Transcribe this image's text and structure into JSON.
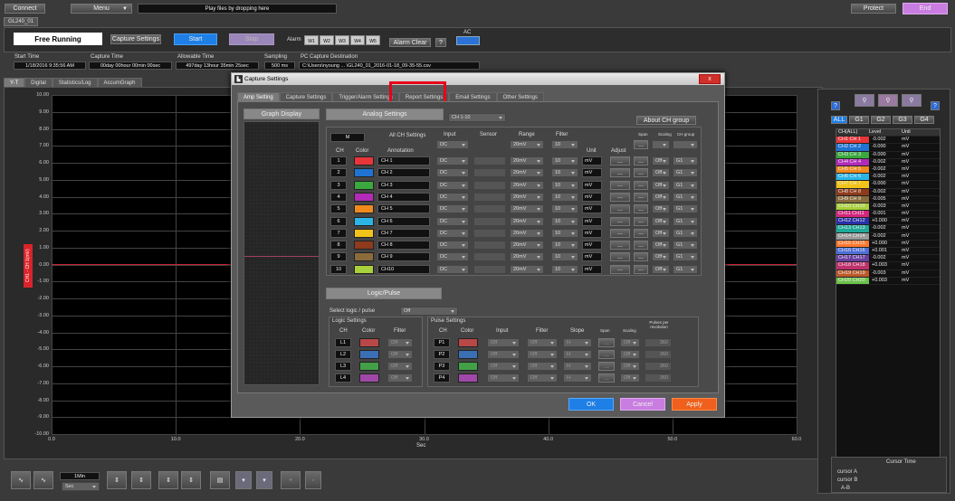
{
  "top": {
    "connect": "Connect",
    "menu": "Menu",
    "drop": "Play files by dropping here",
    "protect": "Protect",
    "end": "End"
  },
  "device_tab": "GL240_01",
  "status": {
    "mode": "Free Running",
    "capture_settings": "Capture Settings",
    "start": "Start",
    "stop": "Stop",
    "alarm_label": "Alarm",
    "alarms": [
      "W1",
      "W2",
      "W3",
      "W4",
      "W5"
    ],
    "alarm_clear": "Alarm Clear",
    "help": "?",
    "ac_label": "AC"
  },
  "info": {
    "start_time_label": "Start Time",
    "start_time": "1/18/2016 9:35:56 AM",
    "capture_time_label": "Capture Time",
    "capture_time": "00day 00hour 00min 00sec",
    "allowable_label": "Allowable Time",
    "allowable": "497day 13hour 35min 25sec",
    "sampling_label": "Sampling",
    "sampling": "500 ms",
    "dest_label": "PC Capture Destination",
    "dest": "C:\\Users\\nyoung ... \\GL240_01_2016-01-18_09-35-55.csv"
  },
  "view_tabs": [
    "Y-T",
    "Digital",
    "Statistics/Log",
    "AccumGraph"
  ],
  "graph": {
    "y_ticks": [
      "10.00",
      "9.00",
      "8.00",
      "7.00",
      "6.00",
      "5.00",
      "4.00",
      "3.00",
      "2.00",
      "1.00",
      "0.00",
      "-1.00",
      "-2.00",
      "-3.00",
      "-4.00",
      "-5.00",
      "-6.00",
      "-7.00",
      "-8.00",
      "-9.00",
      "-10.00"
    ],
    "x_ticks": [
      "0.0",
      "10.0",
      "20.0",
      "30.0",
      "40.0",
      "50.0",
      "60.0"
    ],
    "x_label": "Sec",
    "ch_label": "CH1 - CH 1(mV)"
  },
  "right": {
    "groups": [
      "ALL",
      "G1",
      "G2",
      "G3",
      "G4"
    ],
    "headers": [
      "CH(ALL)",
      "Level",
      "Unit"
    ],
    "channels": [
      [
        "CH1 CH 1",
        "-0.002",
        "mV"
      ],
      [
        "CH2 CH 2",
        "-0.000",
        "mV"
      ],
      [
        "CH3 CH 3",
        "-0.000",
        "mV"
      ],
      [
        "CH4 CH 4",
        "-0.002",
        "mV"
      ],
      [
        "CH5 CH 5",
        "-0.002",
        "mV"
      ],
      [
        "CH6 CH 6",
        "-0.002",
        "mV"
      ],
      [
        "CH7 CH 7",
        "-0.000",
        "mV"
      ],
      [
        "CH8 CH 8",
        "-0.002",
        "mV"
      ],
      [
        "CH9 CH 9",
        "-0.005",
        "mV"
      ],
      [
        "CH10 CH10",
        "-0.003",
        "mV"
      ],
      [
        "CH11 CH11",
        "-0.001",
        "mV"
      ],
      [
        "CH12 CH12",
        "+0.000",
        "mV"
      ],
      [
        "CH13 CH13",
        "-0.002",
        "mV"
      ],
      [
        "CH14 CH14",
        "-0.002",
        "mV"
      ],
      [
        "CH15 CH15",
        "+0.000",
        "mV"
      ],
      [
        "CH16 CH16",
        "+0.001",
        "mV"
      ],
      [
        "CH17 CH17",
        "-0.002",
        "mV"
      ],
      [
        "CH18 CH18",
        "+0.003",
        "mV"
      ],
      [
        "CH19 CH19",
        "-0.003",
        "mV"
      ],
      [
        "CH20 CH20",
        "+0.003",
        "mV"
      ]
    ],
    "cursor_time": "Cursor Time",
    "cursor_a": "cursor A",
    "cursor_b": "cursor B",
    "a_b": "A-B"
  },
  "channel_colors": [
    "#e8353a",
    "#1f73d1",
    "#3aa83e",
    "#b22bb8",
    "#f08a1c",
    "#2bb5e6",
    "#f2c318",
    "#8e3a1c",
    "#8a6b3c",
    "#a9d13b",
    "#d4267c",
    "#2a2fa8",
    "#1fa89a",
    "#9a9a9a",
    "#ff7a30",
    "#4d6fd6",
    "#6a3fa0",
    "#c0306b",
    "#bc5a2a",
    "#6cc24a"
  ],
  "bottom": {
    "time_div": "1Min",
    "unit": "Sec"
  },
  "dialog": {
    "title": "Capture Settings",
    "close": "x",
    "tabs": [
      "Amp Setting",
      "Capture Settings",
      "Trigger/Alarm Settings",
      "Report Settings",
      "Email Settings",
      "Other Settings"
    ],
    "graph_display": "Graph Display",
    "analog": "Analog Settings",
    "ch_range": "CH 1-10",
    "about": "About CH group",
    "headers": {
      "input": "Input",
      "sensor": "Sensor",
      "range": "Range",
      "filter": "Filter",
      "all_ch": "All CH Settings",
      "ch": "CH",
      "color": "Color",
      "annotation": "Annotation",
      "unit": "Unit",
      "adjust": "Adjust",
      "span": "Span",
      "scaling": "Scaling",
      "ch_group": "CH group"
    },
    "all_row": {
      "m": "M",
      "input": "DC",
      "range": "20mV",
      "filter": "10"
    },
    "rows": [
      {
        "ch": "1",
        "ann": "CH 1"
      },
      {
        "ch": "2",
        "ann": "CH 2"
      },
      {
        "ch": "3",
        "ann": "CH 3"
      },
      {
        "ch": "4",
        "ann": "CH 4"
      },
      {
        "ch": "5",
        "ann": "CH 5"
      },
      {
        "ch": "6",
        "ann": "CH 6"
      },
      {
        "ch": "7",
        "ann": "CH 7"
      },
      {
        "ch": "8",
        "ann": "CH 8"
      },
      {
        "ch": "9",
        "ann": "CH 9"
      },
      {
        "ch": "10",
        "ann": "CH10"
      }
    ],
    "row_values": {
      "input": "DC",
      "range": "20mV",
      "filter": "10",
      "unit": "mV",
      "adjust": "...",
      "span": "...",
      "scaling": "Off",
      "group": "G1"
    },
    "logic_pulse": "Logic/Pulse",
    "select_logic": "Select logic / pulse",
    "select_val": "Off",
    "logic_settings": "Logic Settings",
    "pulse_settings": "Pulse Settings",
    "logic_headers": [
      "CH",
      "Color",
      "Filter"
    ],
    "logic_rows": [
      "L1",
      "L2",
      "L3",
      "L4"
    ],
    "logic_colors": [
      "#b84848",
      "#3b6fb5",
      "#43a048",
      "#a048a8"
    ],
    "pulse_headers": [
      "CH",
      "Color",
      "Input",
      "Filter",
      "Slope",
      "Span",
      "Scaling",
      "Pulses per revolution"
    ],
    "pulse_rows": [
      "P1",
      "P2",
      "P3",
      "P4"
    ],
    "pulse_values": {
      "input": "Off",
      "filter": "Off",
      "slope": "H",
      "span": "...",
      "scaling": "Off",
      "ppr": "360"
    },
    "ok": "OK",
    "cancel": "Cancel",
    "apply": "Apply"
  }
}
